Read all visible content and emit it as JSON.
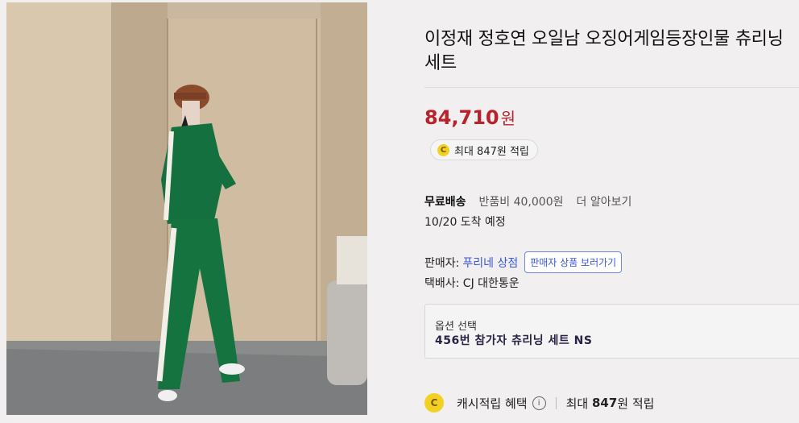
{
  "product": {
    "title": "이정재 정호연 오일남 오징어게임등장인물 츄리닝세트",
    "price": "84,710",
    "price_unit": "원",
    "cash_reward": "최대 847원 적립"
  },
  "shipping": {
    "free_label": "무료배송",
    "return_fee": "반품비 40,000원",
    "more_link": "더 알아보기",
    "arrival": "10/20 도착 예정"
  },
  "seller": {
    "label": "판매자:",
    "name": "푸리네 상점",
    "view_products_button": "판매자 상품 보러가기"
  },
  "courier": {
    "text": "택배사: CJ 대한통운"
  },
  "option": {
    "label": "옵션 선택",
    "selected": "456번 참가자 츄리닝 세트 NS"
  },
  "benefit": {
    "coin_letter": "C",
    "label": "캐시적립 혜택",
    "info_icon": "i",
    "max_prefix": "최대",
    "max_amount": "847",
    "max_suffix": "원 적립"
  },
  "icons": {
    "coin": "coin-c-icon",
    "info": "info-circle-icon"
  },
  "colors": {
    "price": "#b8232b",
    "link": "#3a58d8",
    "coin": "#f2d024"
  }
}
